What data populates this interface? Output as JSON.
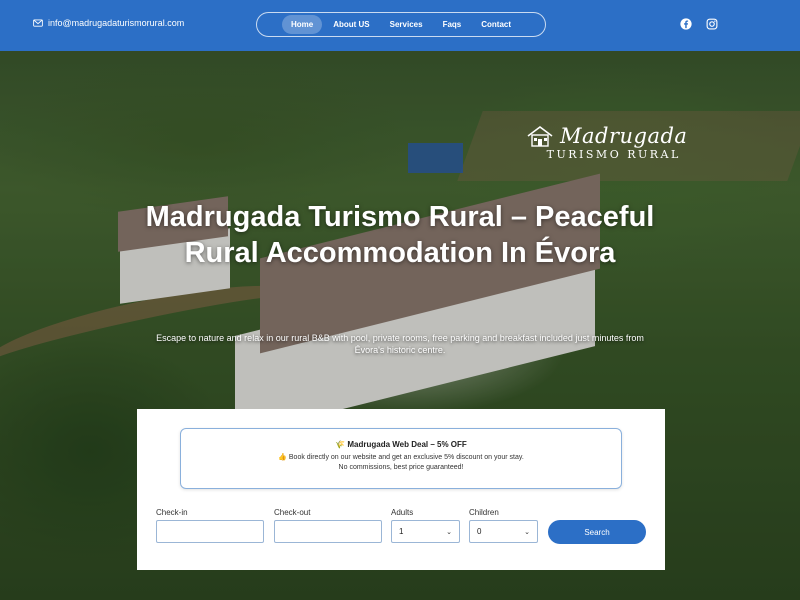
{
  "header": {
    "email": "info@madrugadaturismorural.com",
    "nav": [
      {
        "label": "Home",
        "active": true
      },
      {
        "label": "About US",
        "active": false
      },
      {
        "label": "Services",
        "active": false
      },
      {
        "label": "Faqs",
        "active": false
      },
      {
        "label": "Contact",
        "active": false
      }
    ],
    "social": [
      "facebook-icon",
      "instagram-icon"
    ],
    "accent": "#2c6fc6"
  },
  "logo": {
    "script": "Madrugada",
    "sub": "TURISMO RURAL"
  },
  "hero": {
    "title": "Madrugada Turismo Rural – Peaceful Rural Accommodation In Évora",
    "subtitle": "Escape to nature and relax in our rural B&B with pool, private rooms, free parking and breakfast included  just minutes from Évora's historic centre."
  },
  "booking": {
    "deal_title": "🌾  Madrugada Web Deal – 5% OFF",
    "deal_line1": "👍 Book directly on our website and get an exclusive 5% discount on your stay.",
    "deal_line2": "No commissions, best price guaranteed!",
    "checkin_label": "Check-in",
    "checkin_value": "",
    "checkout_label": "Check-out",
    "checkout_value": "",
    "adults_label": "Adults",
    "adults_value": "1",
    "children_label": "Children",
    "children_value": "0",
    "search_label": "Search"
  }
}
